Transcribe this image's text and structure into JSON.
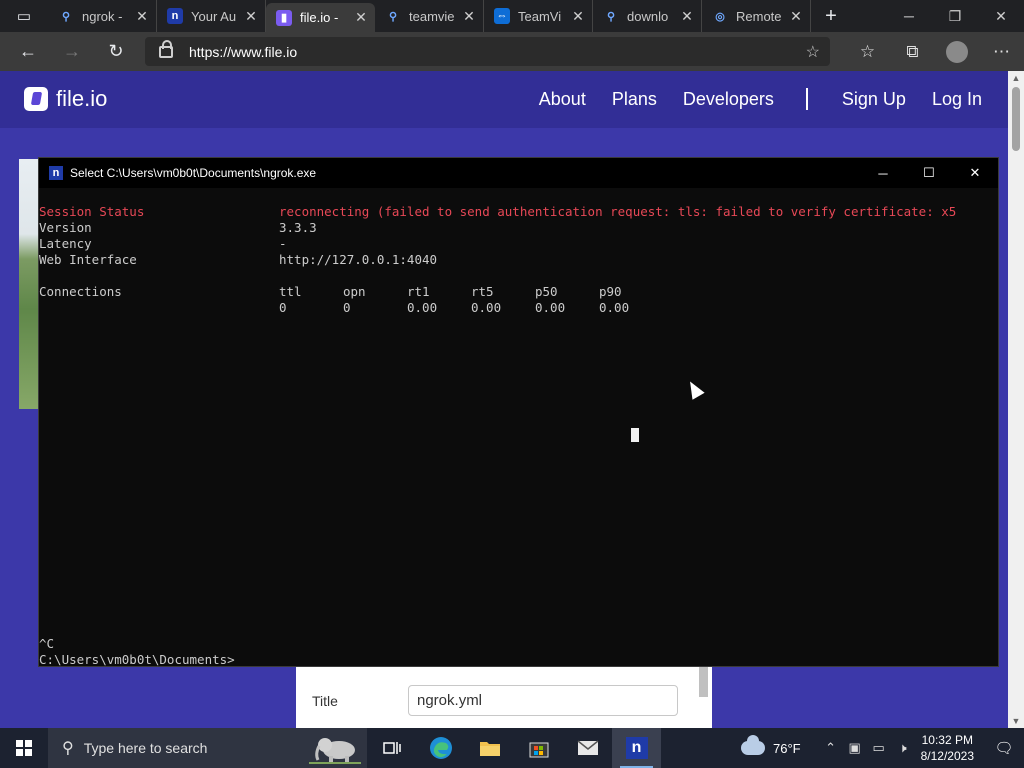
{
  "browser": {
    "tabs": [
      {
        "title": "ngrok -",
        "favicon": "search-icon",
        "active": false
      },
      {
        "title": "Your Au",
        "favicon": "ngrok-icon",
        "active": false
      },
      {
        "title": "file.io -",
        "favicon": "fileio-icon",
        "active": true
      },
      {
        "title": "teamvie",
        "favicon": "search-icon",
        "active": false
      },
      {
        "title": "TeamVi",
        "favicon": "teamviewer-icon",
        "active": false
      },
      {
        "title": "downlo",
        "favicon": "search-icon",
        "active": false
      },
      {
        "title": "Remote",
        "favicon": "remote-icon",
        "active": false
      }
    ],
    "url": "https://www.file.io"
  },
  "site": {
    "logo_text": "file.io",
    "nav": {
      "about": "About",
      "plans": "Plans",
      "developers": "Developers",
      "signup": "Sign Up",
      "login": "Log In"
    },
    "form": {
      "title_label": "Title",
      "title_value": "ngrok.yml"
    }
  },
  "console": {
    "title": "Select C:\\Users\\vm0b0t\\Documents\\ngrok.exe",
    "status_label": "Session Status",
    "status_value": "reconnecting (failed to send authentication request: tls: failed to verify certificate: x5",
    "version_label": "Version",
    "version_value": "3.3.3",
    "latency_label": "Latency",
    "latency_value": "-",
    "web_label": "Web Interface",
    "web_value": "http://127.0.0.1:4040",
    "connections_label": "Connections",
    "conn_headers": [
      "ttl",
      "opn",
      "rt1",
      "rt5",
      "p50",
      "p90"
    ],
    "conn_values": [
      "0",
      "0",
      "0.00",
      "0.00",
      "0.00",
      "0.00"
    ],
    "ctrl_c": "^C",
    "prompt": "C:\\Users\\vm0b0t\\Documents>"
  },
  "taskbar": {
    "search_placeholder": "Type here to search",
    "temperature": "76°F",
    "time": "10:32 PM",
    "date": "8/12/2023"
  },
  "colors": {
    "console_red": "#e74856",
    "site_bg": "#3c38a9",
    "taskbar_bg": "#1c2230"
  }
}
